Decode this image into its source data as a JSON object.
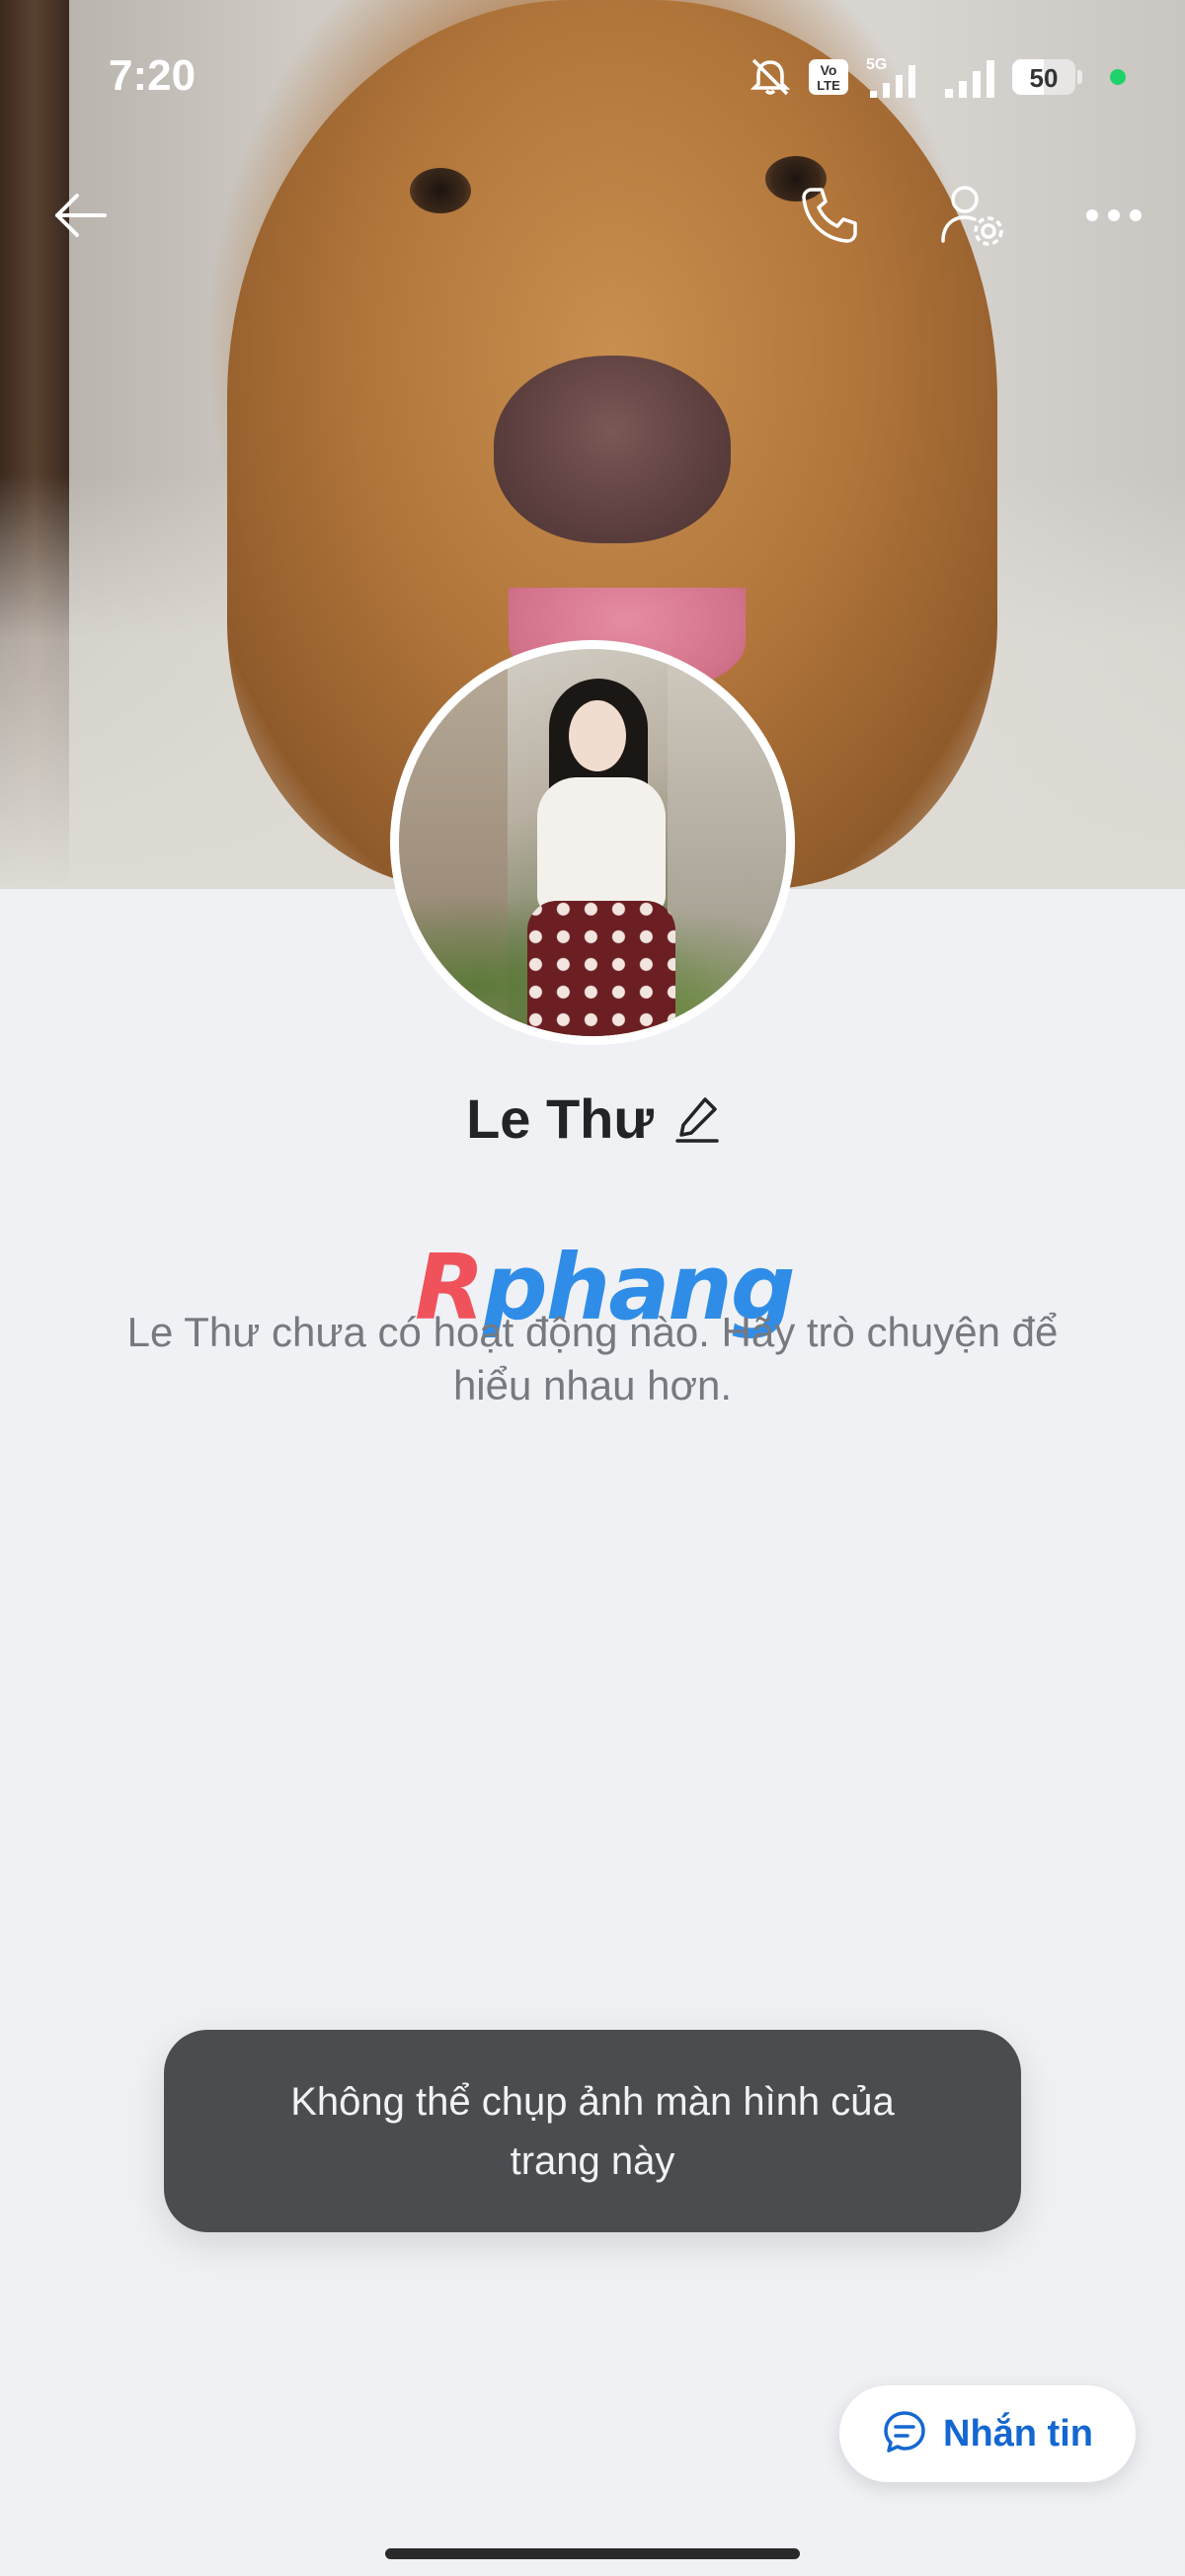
{
  "status_bar": {
    "time": "7:20",
    "network": "5G",
    "volte": "VoLTE",
    "battery_level": "50",
    "battery_fraction": 0.5
  },
  "header": {
    "back_icon": "arrow-left-icon",
    "call_icon": "phone-icon",
    "settings_icon": "user-settings-icon",
    "more_icon": "more-horizontal-icon"
  },
  "profile": {
    "name": "Le Thư",
    "edit_icon": "pencil-icon",
    "empty_message": "Le Thư chưa có hoạt động nào. Hãy trò chuyện để hiểu nhau hơn."
  },
  "watermark": {
    "part1": "R",
    "part2": "phang"
  },
  "toast": {
    "message": "Không thể chụp ảnh màn hình của trang này"
  },
  "message_button": {
    "label": "Nhắn tin",
    "icon": "chat-bubble-icon"
  },
  "colors": {
    "accent": "#1467d1",
    "background": "#eff1f5",
    "toast_bg": "#4a4d50",
    "status_dot": "#1fd26a"
  }
}
